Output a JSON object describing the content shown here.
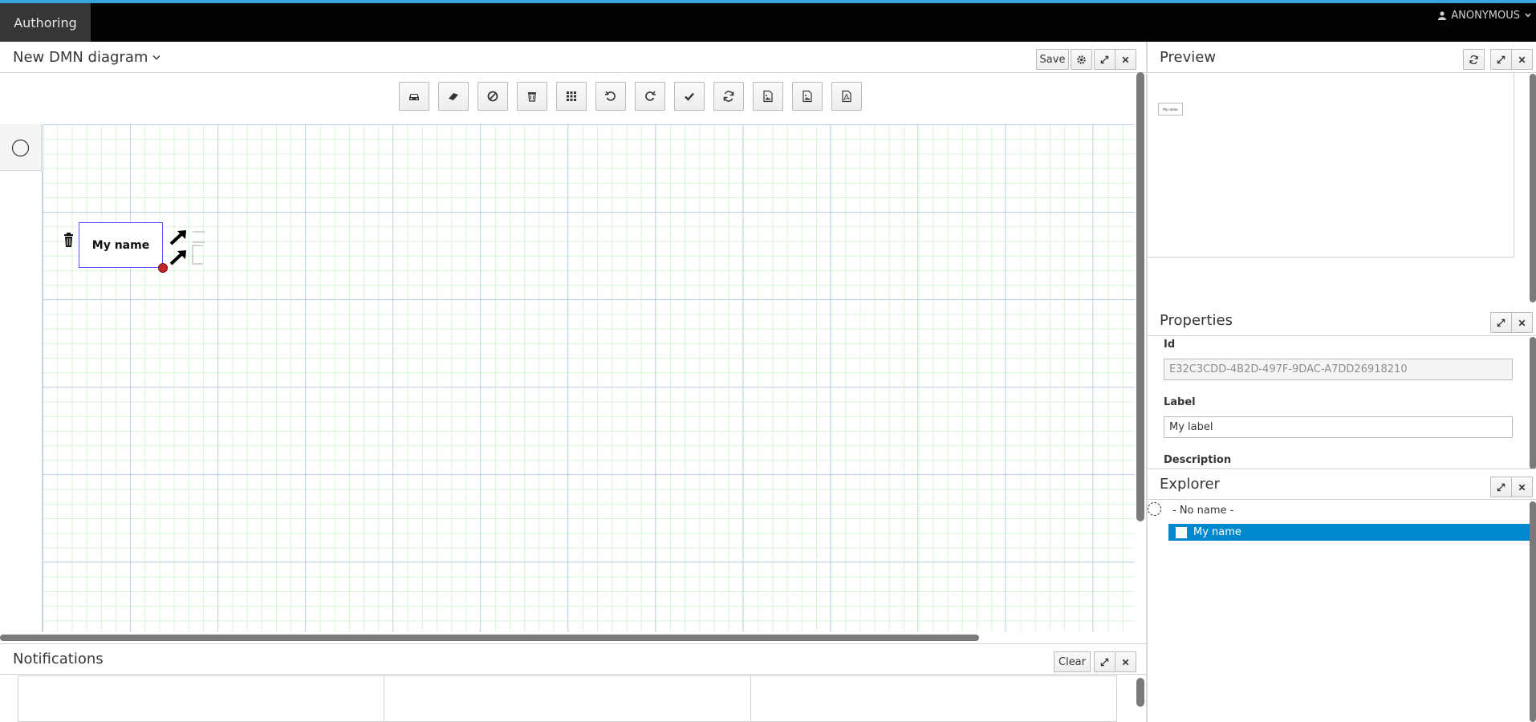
{
  "topbar": {
    "tab_label": "Authoring",
    "user_label": "ANONYMOUS"
  },
  "editor": {
    "title": "New DMN diagram",
    "buttons": {
      "save": "Save"
    },
    "toolbar_icons": [
      "car-icon",
      "eraser-icon",
      "ban-icon",
      "trash-icon",
      "grid-icon",
      "undo-icon",
      "redo-icon",
      "check-icon",
      "refresh-icon",
      "export-png-icon",
      "export-jpg-icon",
      "export-pdf-icon"
    ],
    "node": {
      "label": "My name"
    }
  },
  "notifications": {
    "title": "Notifications",
    "clear_label": "Clear"
  },
  "preview": {
    "title": "Preview",
    "mini_label": "My name"
  },
  "properties": {
    "title": "Properties",
    "id_label": "Id",
    "id_value": "E32C3CDD-4B2D-497F-9DAC-A7DD26918210",
    "label_label": "Label",
    "label_value": "My label",
    "description_label": "Description"
  },
  "explorer": {
    "title": "Explorer",
    "root": "- No name -",
    "items": [
      "My name"
    ]
  },
  "colors": {
    "accent": "#39a5dc",
    "selection": "#0088ce",
    "node_border": "#5555ff"
  }
}
